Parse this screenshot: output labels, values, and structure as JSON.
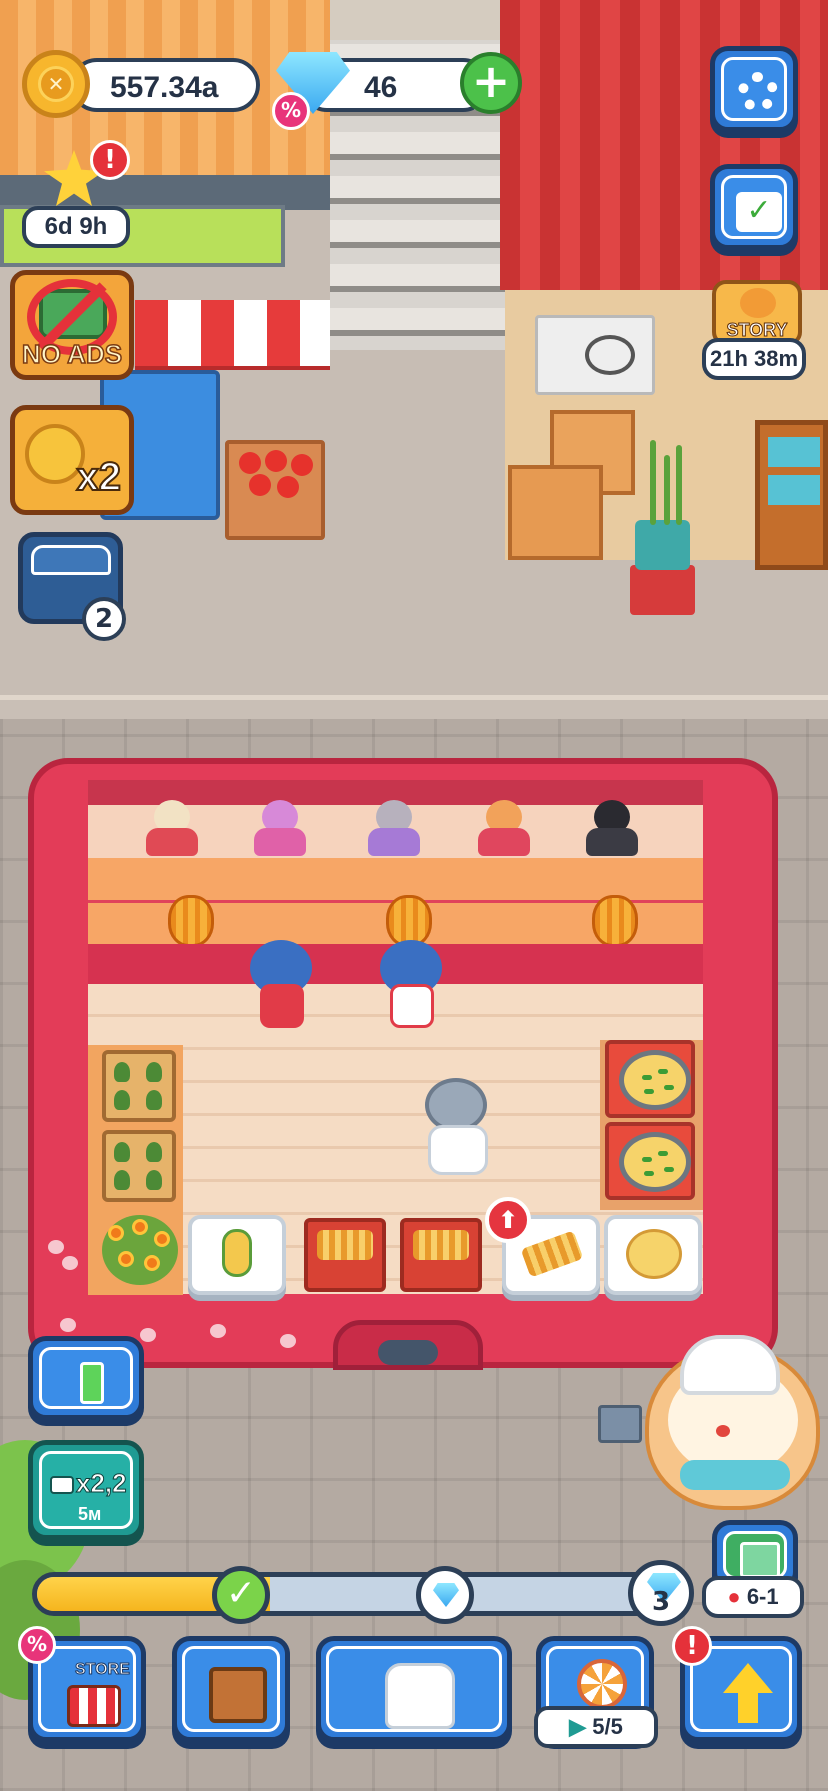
{
  "hud": {
    "coins": "557.34a",
    "gems": "46",
    "gem_discount_badge": "%",
    "add_gems_symbol": "+"
  },
  "side_left": {
    "event_timer": "6d 9h",
    "event_alert": "!",
    "no_ads_label": "NO ADS",
    "double_income_label": "x2",
    "chest_count": "2",
    "energy_icon": "battery-icon",
    "video_boost_label": "x2,2",
    "video_boost_time": "5м"
  },
  "side_right": {
    "settings_icon": "gear-icon",
    "calendar_icon": "calendar-check-icon",
    "story_label": "STORY",
    "story_timer": "21h 38m",
    "map_level": "6-1"
  },
  "progress": {
    "fill_fraction": 0.37,
    "milestone_check": "✓",
    "milestone_end_number": "3"
  },
  "bottom_nav": {
    "store_label": "STORE",
    "store_badge": "%",
    "wardrobe_icon": "shelf-icon",
    "outfit_icon": "chef-jacket-icon",
    "wheel_count": "5/5",
    "upgrade_alert": "!",
    "upgrade_icon": "up-arrow-icon"
  },
  "shop": {
    "upgrade_badge_symbol": "⬆"
  },
  "colors": {
    "accent_blue": "#2f7bd8",
    "truck_red": "#e33c58",
    "coin_gold": "#f7b62d",
    "outline_navy": "#2c3f57"
  }
}
